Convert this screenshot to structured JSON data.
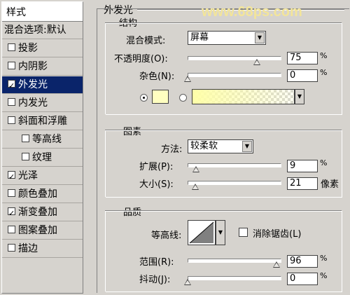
{
  "watermark": "www.68ps.com",
  "styles_panel": {
    "title": "样式",
    "items": [
      {
        "label": "混合选项:默认",
        "checkbox": false,
        "checked": false,
        "selected": false,
        "indent": false
      },
      {
        "label": "投影",
        "checkbox": true,
        "checked": false,
        "selected": false,
        "indent": false
      },
      {
        "label": "内阴影",
        "checkbox": true,
        "checked": false,
        "selected": false,
        "indent": false
      },
      {
        "label": "外发光",
        "checkbox": true,
        "checked": true,
        "selected": true,
        "indent": false
      },
      {
        "label": "内发光",
        "checkbox": true,
        "checked": false,
        "selected": false,
        "indent": false
      },
      {
        "label": "斜面和浮雕",
        "checkbox": true,
        "checked": false,
        "selected": false,
        "indent": false
      },
      {
        "label": "等高线",
        "checkbox": true,
        "checked": false,
        "selected": false,
        "indent": true
      },
      {
        "label": "纹理",
        "checkbox": true,
        "checked": false,
        "selected": false,
        "indent": true
      },
      {
        "label": "光泽",
        "checkbox": true,
        "checked": true,
        "selected": false,
        "indent": false
      },
      {
        "label": "颜色叠加",
        "checkbox": true,
        "checked": false,
        "selected": false,
        "indent": false
      },
      {
        "label": "渐变叠加",
        "checkbox": true,
        "checked": true,
        "selected": false,
        "indent": false
      },
      {
        "label": "图案叠加",
        "checkbox": true,
        "checked": false,
        "selected": false,
        "indent": false
      },
      {
        "label": "描边",
        "checkbox": true,
        "checked": false,
        "selected": false,
        "indent": false
      }
    ]
  },
  "outer_glow": {
    "section_title": "外发光",
    "structure": {
      "title": "结构",
      "blend_mode_label": "混合模式:",
      "blend_mode_value": "屏幕",
      "opacity_label": "不透明度(O):",
      "opacity_value": "75",
      "opacity_level": 0.75,
      "noise_label": "杂色(N):",
      "noise_value": "0",
      "noise_level": 0,
      "percent": "%",
      "glow_color": "#ffffc0",
      "gradient_color": "#ffffa8"
    },
    "elements": {
      "title": "图素",
      "technique_label": "方法:",
      "technique_value": "较柔软",
      "spread_label": "扩展(P):",
      "spread_value": "9",
      "spread_level": 0.09,
      "size_label": "大小(S):",
      "size_value": "21",
      "size_level": 0.084,
      "size_unit": "像素",
      "percent": "%"
    },
    "quality": {
      "title": "品质",
      "contour_label": "等高线:",
      "antialias_label": "消除锯齿(L)",
      "range_label": "范围(R):",
      "range_value": "96",
      "range_level": 0.96,
      "jitter_label": "抖动(J):",
      "jitter_value": "0",
      "jitter_level": 0,
      "percent": "%"
    }
  }
}
